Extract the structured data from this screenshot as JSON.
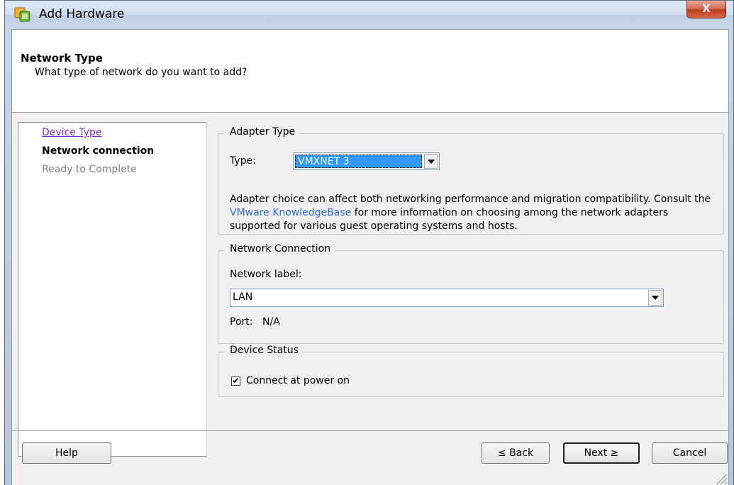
{
  "window": {
    "title": "Add Hardware",
    "close_glyph": "X",
    "app_icon": "vsphere-icon"
  },
  "header": {
    "title": "Network Type",
    "subtitle": "What type of network do you want to add?"
  },
  "steps": [
    {
      "label": "Device Type",
      "state": "completed"
    },
    {
      "label": "Network connection",
      "state": "current"
    },
    {
      "label": "Ready to Complete",
      "state": "pending"
    }
  ],
  "adapter_type": {
    "group_title": "Adapter Type",
    "type_label": "Type:",
    "type_value": "VMXNET 3",
    "description_before": "Adapter choice can affect both networking performance and migration compatibility. Consult the ",
    "description_link": "VMware KnowledgeBase",
    "description_after": " for more information on choosing among the network adapters supported for various guest operating systems and hosts."
  },
  "network_connection": {
    "group_title": "Network Connection",
    "network_label": "Network label:",
    "network_value": "LAN",
    "port_label": "Port:",
    "port_value": "N/A"
  },
  "device_status": {
    "group_title": "Device Status",
    "checkbox_label": "Connect at power on",
    "checked": true,
    "check_glyph": "✔"
  },
  "buttons": {
    "help": "Help",
    "back": "≤ Back",
    "next": "Next ≥",
    "cancel": "Cancel"
  },
  "colors": {
    "link_visited": "#7a2cd8",
    "link": "#2d6ed8",
    "selection": "#3399ff",
    "close_button": "#c23a1f"
  }
}
